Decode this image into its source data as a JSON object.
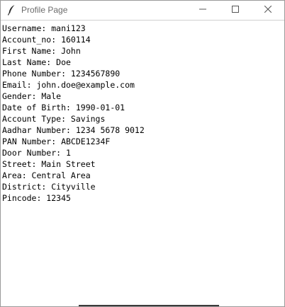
{
  "window": {
    "title": "Profile Page",
    "app_icon": "feather-icon",
    "controls": [
      "minimize-icon",
      "maximize-icon",
      "close-icon"
    ]
  },
  "profile": {
    "lines": [
      "Username: mani123",
      "Account_no: 160114",
      "First Name: John",
      "Last Name: Doe",
      "Phone Number: 1234567890",
      "Email: john.doe@example.com",
      "Gender: Male",
      "Date of Birth: 1990-01-01",
      "Account Type: Savings",
      "Aadhar Number: 1234 5678 9012",
      "PAN Number: ABCDE1234F",
      "Door Number: 1",
      "Street: Main Street",
      "Area: Central Area",
      "District: Cityville",
      "Pincode: 12345"
    ]
  }
}
